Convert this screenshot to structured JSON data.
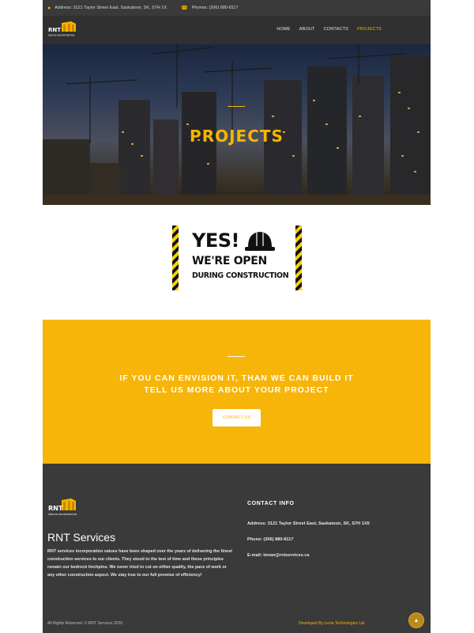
{
  "topbar": {
    "address": "Address: 3121 Taylor Street East, Saskatoon, SK, S7H 1X",
    "phone": "Phones: (306) 880-8117",
    "address_icon": "map-marker-icon",
    "phone_icon": "phone-icon"
  },
  "brand": {
    "name": "RNT",
    "tagline": "SERVICE INCORPORATION"
  },
  "nav": {
    "items": [
      "HOME",
      "ABOUT",
      "CONTACTS",
      "PROJECTS"
    ],
    "active": "PROJECTS"
  },
  "hero": {
    "title": "PROJECTS"
  },
  "sign": {
    "line1": "YES!",
    "line2": "WE'RE OPEN",
    "line3": "DURING CONSTRUCTION"
  },
  "cta": {
    "heading1": "IF YOU CAN ENVISION IT, THAN WE CAN BUILD IT",
    "heading2": "TELL US MORE ABOUT YOUR PROJECT",
    "button": "CONTACT US"
  },
  "footer": {
    "title": "RNT Services",
    "description": "RNT services incorporation values have been shaped over the years of delivering the finest construction services to our clients. They stood to the test of time and these principles remain our bedrock linchpins. We never tried to cut on either quality, the pace of work or any other construction aspect. We stay true to our full promise of efficiency!",
    "contact_heading": "CONTACT INFO",
    "address": "Address: 3121 Taylor Street East, Saskatoon, SK, S7H 1X5",
    "phone": "Phone: (306) 880-8117",
    "email": "E-mail: imran@rntservices.ca",
    "copyright": "All Rights Reserved. © RNT Services 2020.",
    "developer": "Developed By Lexia Technologies Ltd.",
    "back_to_top_icon": "chevron-up-icon"
  },
  "colors": {
    "accent": "#f7b500",
    "dark": "#303030",
    "footer": "#3a3a3a"
  }
}
